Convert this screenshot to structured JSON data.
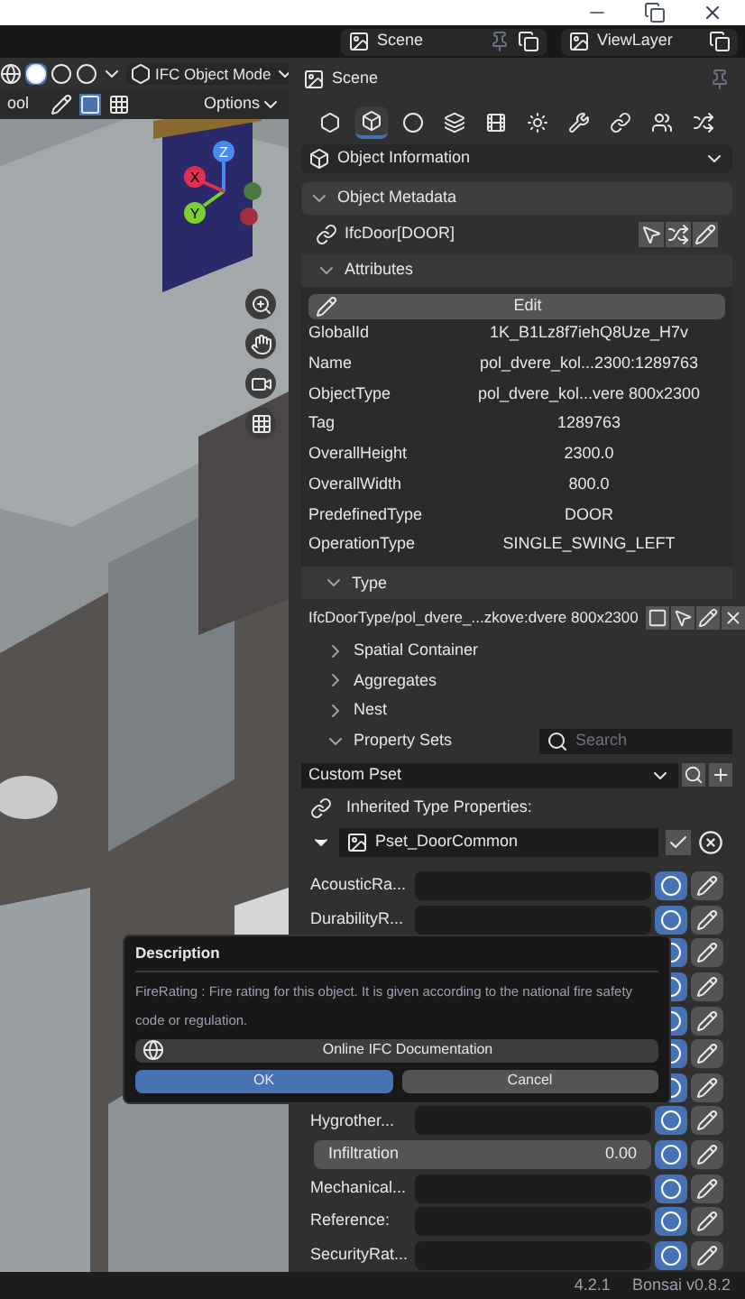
{
  "topbar": {
    "scene": "Scene",
    "view_layer": "ViewLayer"
  },
  "viewport": {
    "mode": "IFC Object Mode",
    "tool": "ool",
    "options": "Options",
    "gizmo": [
      "Z",
      "X",
      "Y"
    ]
  },
  "properties": {
    "header": "Scene",
    "tabs": [
      {
        "selected": false
      },
      {
        "selected": true
      },
      {
        "selected": false
      },
      {
        "selected": false
      },
      {
        "selected": false
      },
      {
        "selected": false
      },
      {
        "selected": false
      },
      {
        "selected": false
      },
      {
        "selected": false
      },
      {
        "selected": false
      }
    ],
    "panel": "Object Information",
    "metadata": {
      "title": "Object Metadata",
      "entity": "IfcDoor[DOOR]"
    },
    "attributes": {
      "title": "Attributes",
      "edit": "Edit",
      "rows": [
        {
          "name": "GlobalId",
          "value": "1K_B1Lz8f7iehQ8Uze_H7v"
        },
        {
          "name": "Name",
          "value": "pol_dvere_kol...2300:1289763"
        },
        {
          "name": "ObjectType",
          "value": "pol_dvere_kol...vere 800x2300"
        },
        {
          "name": "Tag",
          "value": "1289763"
        },
        {
          "name": "OverallHeight",
          "value": "2300.0"
        },
        {
          "name": "OverallWidth",
          "value": "800.0"
        },
        {
          "name": "PredefinedType",
          "value": "DOOR"
        },
        {
          "name": "OperationType",
          "value": "SINGLE_SWING_LEFT"
        }
      ]
    },
    "type": {
      "title": "Type",
      "value": "IfcDoorType/pol_dvere_...zkove:dvere 800x2300"
    },
    "sections": [
      {
        "label": "Spatial Container",
        "expanded": false
      },
      {
        "label": "Aggregates",
        "expanded": false
      },
      {
        "label": "Nest",
        "expanded": false
      },
      {
        "label": "Property Sets",
        "expanded": true
      }
    ],
    "search": {
      "placeholder": "Search"
    },
    "pset_select": "Custom Pset",
    "inherited": "Inherited Type Properties:",
    "pset": {
      "name": "Pset_DoorCommon",
      "expanded": true
    },
    "props": [
      {
        "kind": "text",
        "label": "AcousticRa..."
      },
      {
        "kind": "text",
        "label": "DurabilityR..."
      },
      {
        "kind": "hidden"
      },
      {
        "kind": "hidden"
      },
      {
        "kind": "hidden"
      },
      {
        "kind": "hidden"
      },
      {
        "kind": "hidden"
      },
      {
        "kind": "text",
        "label": "Hygrother..."
      },
      {
        "kind": "number",
        "label": "Infiltration",
        "value": "0.00"
      },
      {
        "kind": "text",
        "label": "Mechanical..."
      },
      {
        "kind": "text",
        "label": "Reference:"
      },
      {
        "kind": "text",
        "label": "SecurityRat..."
      }
    ]
  },
  "dialog": {
    "title": "Description",
    "text": "FireRating : Fire rating for this object. It is given according to the national fire safety code or regulation.",
    "doc_button": "Online IFC Documentation",
    "ok": "OK",
    "cancel": "Cancel"
  },
  "status": {
    "version": "4.2.1",
    "addon": "Bonsai v0.8.2"
  }
}
